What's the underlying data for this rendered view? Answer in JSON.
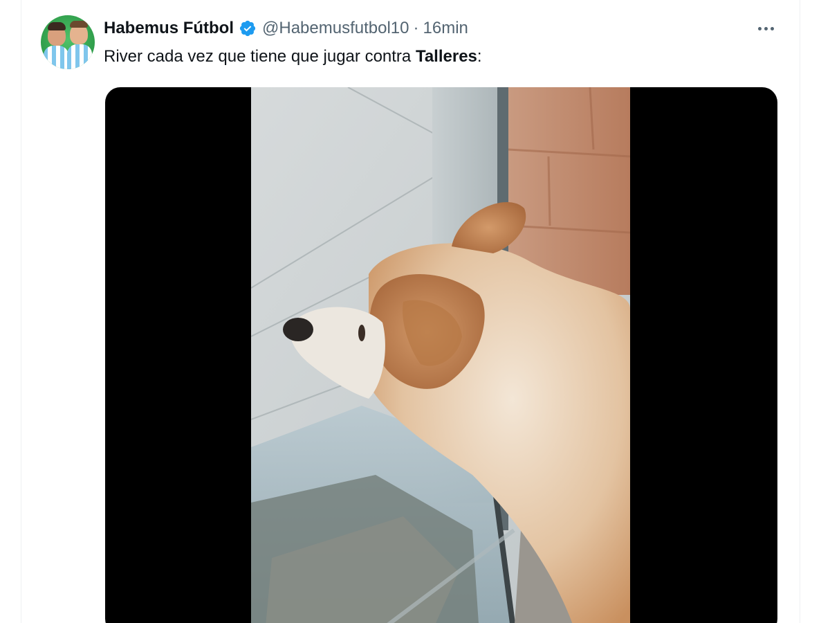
{
  "tweet": {
    "display_name": "Habemus Fútbol",
    "handle": "@Habemusfutbol10",
    "separator": "·",
    "time": "16min",
    "text_prefix": "River cada vez que tiene que jugar contra ",
    "text_bold": "Talleres",
    "text_suffix": ":"
  },
  "icons": {
    "verified": "verified-badge-icon",
    "more": "more-options-icon"
  },
  "colors": {
    "verified": "#1d9bf0",
    "text_primary": "#0f1419",
    "text_secondary": "#536471",
    "media_bg": "#000000"
  }
}
